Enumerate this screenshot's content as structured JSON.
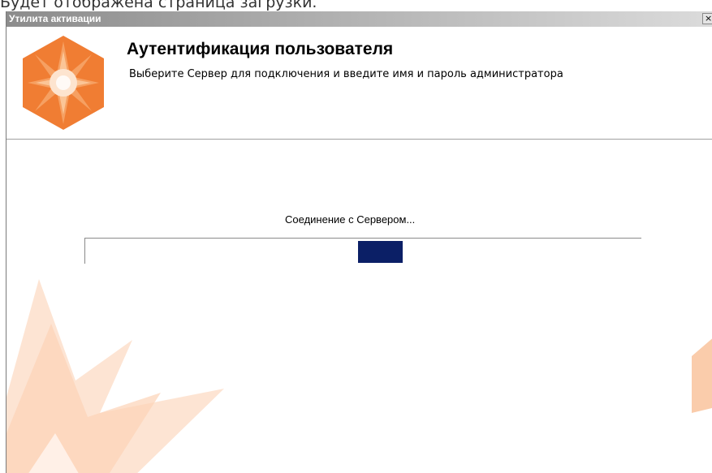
{
  "document": {
    "caption": "Будет отображена страница загрузки."
  },
  "window": {
    "title": "Утилита активации",
    "close_glyph": "×"
  },
  "header": {
    "title": "Аутентификация пользователя",
    "subtitle": "Выберите Сервер для подключения и введите имя и пароль администратора"
  },
  "main": {
    "status": "Соединение с Сервером...",
    "progress": {
      "style": "marquee",
      "chunk_position": 0.53,
      "chunk_color": "#0b1f66"
    }
  },
  "colors": {
    "logo_dark": "#f07d33",
    "logo_light": "#f9b884",
    "watermark": "#fbd8c0"
  }
}
